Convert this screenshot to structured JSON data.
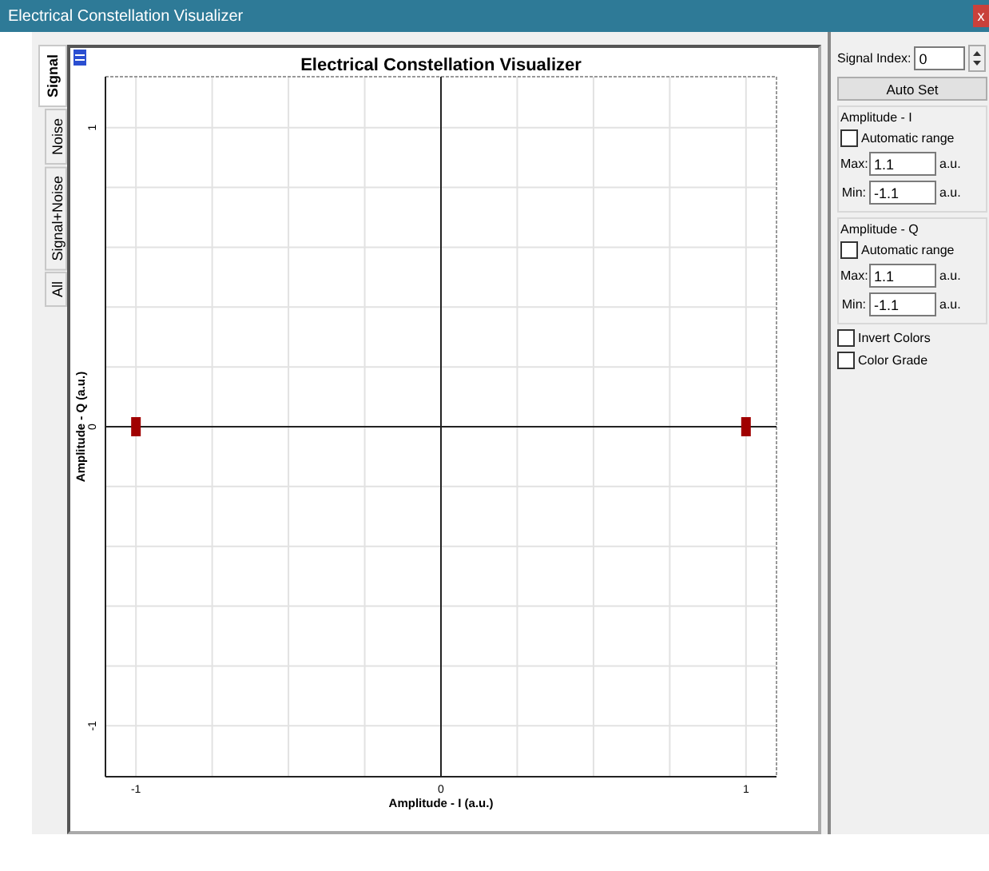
{
  "window": {
    "title": "Electrical Constellation Visualizer",
    "close": "x"
  },
  "tabs": [
    {
      "label": "Signal",
      "selected": true
    },
    {
      "label": "Noise",
      "selected": false
    },
    {
      "label": "Signal+Noise",
      "selected": false
    },
    {
      "label": "All",
      "selected": false
    }
  ],
  "plot": {
    "chart_data": {
      "type": "scatter",
      "title": "Electrical Constellation Visualizer",
      "xlabel": "Amplitude - I (a.u.)",
      "ylabel": "Amplitude - Q (a.u.)",
      "xlim": [
        -1.1,
        1.1
      ],
      "ylim": [
        -1.17,
        1.17
      ],
      "xticks": [
        -1,
        0,
        1
      ],
      "yticks": [
        -1,
        0,
        1
      ],
      "x": [
        -1,
        1
      ],
      "grid": true,
      "series": [
        {
          "color": "#a00000",
          "values": [
            0,
            0
          ]
        }
      ]
    }
  },
  "controls": {
    "signal_index": {
      "label": "Signal Index:",
      "value": "0"
    },
    "auto_set": "Auto Set",
    "groups": [
      {
        "title": "Amplitude - I",
        "automatic": {
          "label": "Automatic range",
          "checked": false
        },
        "max": {
          "label": "Max:",
          "value": "1.1",
          "unit": "a.u."
        },
        "min": {
          "label": "Min:",
          "value": "-1.1",
          "unit": "a.u."
        }
      },
      {
        "title": "Amplitude - Q",
        "automatic": {
          "label": "Automatic range",
          "checked": false
        },
        "max": {
          "label": "Max:",
          "value": "1.1",
          "unit": "a.u."
        },
        "min": {
          "label": "Min:",
          "value": "-1.1",
          "unit": "a.u."
        }
      }
    ],
    "options": [
      {
        "label": "Invert Colors",
        "checked": false
      },
      {
        "label": "Color Grade",
        "checked": false
      }
    ]
  }
}
